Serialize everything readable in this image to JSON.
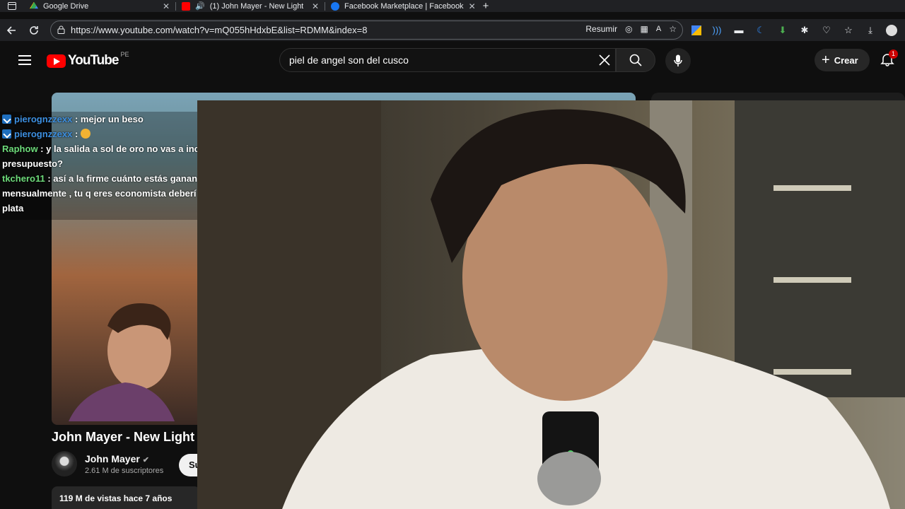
{
  "browser": {
    "tabs": [
      {
        "title": "Google Drive",
        "color": "#34a853"
      },
      {
        "title": "(1) John Mayer - New Light (",
        "color": "#ff0000"
      },
      {
        "title": "Facebook Marketplace | Facebook",
        "color": "#1877f2"
      }
    ],
    "url": "https://www.youtube.com/watch?v=mQ055hHdxbE&list=RDMM&index=8",
    "resumir_label": "Resumir"
  },
  "youtube": {
    "logo_text": "YouTube",
    "country": "PE",
    "search_value": "piel de angel son del cusco",
    "create_label": "Crear",
    "notification_count": "1",
    "video_title": "John Mayer - New Light (",
    "channel_name": "John Mayer",
    "subscribers": "2.61 M de suscriptores",
    "subscribe_label": "Su",
    "stats": "119 M de vistas  hace 7 años"
  },
  "chat": [
    {
      "user": "pierognzzexx",
      "sep": " : ",
      "text": "mejor un beso",
      "platform": true,
      "user_color": "#3d8fe0"
    },
    {
      "user": "pierognzzexx",
      "sep": " : ",
      "text": "",
      "platform": true,
      "emoji": true,
      "user_color": "#3d8fe0"
    },
    {
      "user": "Raphow",
      "sep": " : ",
      "text": "y la salida a sol de oro no vas a incl",
      "platform": false,
      "user_color": "#6ddb7a"
    },
    {
      "user": "",
      "sep": "",
      "text": "presupuesto?",
      "platform": false
    },
    {
      "user": "tkchero11",
      "sep": " : ",
      "text": "así a la firme cuánto estás ganan",
      "platform": false,
      "user_color": "#6ddb7a"
    },
    {
      "user": "",
      "sep": "",
      "text": "mensualmente , tu q eres economista deberí",
      "platform": false
    },
    {
      "user": "",
      "sep": "",
      "text": "plata",
      "platform": false
    }
  ]
}
